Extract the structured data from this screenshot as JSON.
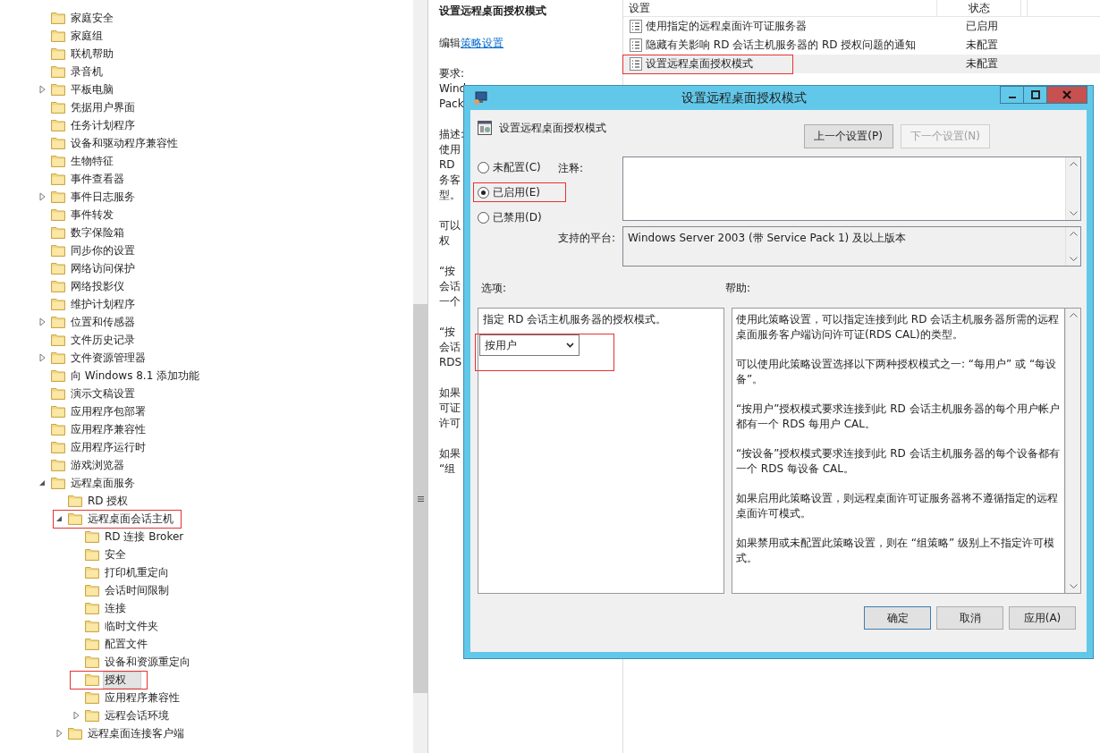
{
  "tree": [
    {
      "label": "家庭安全",
      "selected": false
    },
    {
      "label": "家庭组",
      "selected": false
    },
    {
      "label": "联机帮助",
      "selected": false
    },
    {
      "label": "录音机",
      "selected": false
    },
    {
      "label": "平板电脑",
      "selected": false,
      "expanded": false
    },
    {
      "label": "凭据用户界面",
      "selected": false
    },
    {
      "label": "任务计划程序",
      "selected": false
    },
    {
      "label": "设备和驱动程序兼容性",
      "selected": false
    },
    {
      "label": "生物特征",
      "selected": false
    },
    {
      "label": "事件查看器",
      "selected": false
    },
    {
      "label": "事件日志服务",
      "selected": false,
      "expanded": false
    },
    {
      "label": "事件转发",
      "selected": false
    },
    {
      "label": "数字保险箱",
      "selected": false
    },
    {
      "label": "同步你的设置",
      "selected": false
    },
    {
      "label": "网络访问保护",
      "selected": false
    },
    {
      "label": "网络投影仪",
      "selected": false
    },
    {
      "label": "维护计划程序",
      "selected": false
    },
    {
      "label": "位置和传感器",
      "selected": false,
      "expanded": false
    },
    {
      "label": "文件历史记录",
      "selected": false
    },
    {
      "label": "文件资源管理器",
      "selected": false,
      "expanded": false
    },
    {
      "label": "向 Windows 8.1 添加功能",
      "selected": false
    },
    {
      "label": "演示文稿设置",
      "selected": false
    },
    {
      "label": "应用程序包部署",
      "selected": false
    },
    {
      "label": "应用程序兼容性",
      "selected": false
    },
    {
      "label": "应用程序运行时",
      "selected": false
    },
    {
      "label": "游戏浏览器",
      "selected": false
    },
    {
      "label": "远程桌面服务",
      "selected": false,
      "expanded": true,
      "children": [
        {
          "label": "RD 授权",
          "selected": false
        },
        {
          "label": "远程桌面会话主机",
          "selected": false,
          "expanded": true,
          "annotated": true,
          "children": [
            {
              "label": "RD 连接 Broker",
              "selected": false
            },
            {
              "label": "安全",
              "selected": false
            },
            {
              "label": "打印机重定向",
              "selected": false
            },
            {
              "label": "会话时间限制",
              "selected": false
            },
            {
              "label": "连接",
              "selected": false
            },
            {
              "label": "临时文件夹",
              "selected": false
            },
            {
              "label": "配置文件",
              "selected": false
            },
            {
              "label": "设备和资源重定向",
              "selected": false
            },
            {
              "label": "授权",
              "selected": true,
              "annotated": true
            },
            {
              "label": "应用程序兼容性",
              "selected": false
            },
            {
              "label": "远程会话环境",
              "selected": false,
              "expanded": false
            }
          ]
        },
        {
          "label": "远程桌面连接客户端",
          "selected": false,
          "expanded": false
        }
      ]
    }
  ],
  "details": {
    "title": "设置远程桌面授权模式",
    "edit_prefix": "编辑",
    "edit_link": "策略设置",
    "paragraphs": [
      [
        "要求:",
        "Wind",
        "Pack"
      ],
      [
        "描述:",
        "使用",
        "RD",
        "务客",
        "型。"
      ],
      [
        "可以",
        "权"
      ],
      [
        "“按",
        "会话",
        "一个"
      ],
      [
        "“按",
        "会话",
        "RDS"
      ],
      [
        "如果",
        "可证",
        "许可"
      ],
      [
        "如果",
        "“组"
      ]
    ]
  },
  "settings": {
    "columns": [
      "设置",
      "状态"
    ],
    "rows": [
      {
        "name": "使用指定的远程桌面许可证服务器",
        "status": "已启用",
        "selected": false,
        "annotated": false
      },
      {
        "name": "隐藏有关影响 RD 会话主机服务器的 RD 授权问题的通知",
        "status": "未配置",
        "selected": false,
        "annotated": false
      },
      {
        "name": "设置远程桌面授权模式",
        "status": "未配置",
        "selected": true,
        "annotated": true
      }
    ]
  },
  "dialog": {
    "title": "设置远程桌面授权模式",
    "header": "设置远程桌面授权模式",
    "nav_buttons": [
      {
        "label": "上一个设置(P)",
        "disabled": false
      },
      {
        "label": "下一个设置(N)",
        "disabled": true
      }
    ],
    "states": [
      {
        "label": "未配置(C)",
        "selected": false,
        "annotated": false
      },
      {
        "label": "已启用(E)",
        "selected": true,
        "annotated": true
      },
      {
        "label": "已禁用(D)",
        "selected": false,
        "annotated": false
      }
    ],
    "comment_label": "注释:",
    "platform_label": "支持的平台:",
    "platform": "Windows Server 2003 (带 Service Pack 1) 及以上版本",
    "options_label": "选项:",
    "help_label": "帮助:",
    "option_text": "指定 RD 会话主机服务器的授权模式。",
    "dropdown": {
      "value": "按用户",
      "annotated": true
    },
    "help": [
      "使用此策略设置，可以指定连接到此 RD 会话主机服务器所需的远程桌面服务客户端访问许可证(RDS CAL)的类型。",
      "可以使用此策略设置选择以下两种授权模式之一: “每用户” 或 “每设备”。",
      "“按用户”授权模式要求连接到此 RD 会话主机服务器的每个用户帐户都有一个 RDS 每用户 CAL。",
      "“按设备”授权模式要求连接到此 RD 会话主机服务器的每个设备都有一个 RDS 每设备 CAL。",
      "如果启用此策略设置，则远程桌面许可证服务器将不遵循指定的远程桌面许可模式。",
      "如果禁用或未配置此策略设置，则在 “组策略” 级别上不指定许可模式。"
    ],
    "buttons": [
      "确定",
      "取消",
      "应用(A)"
    ]
  }
}
